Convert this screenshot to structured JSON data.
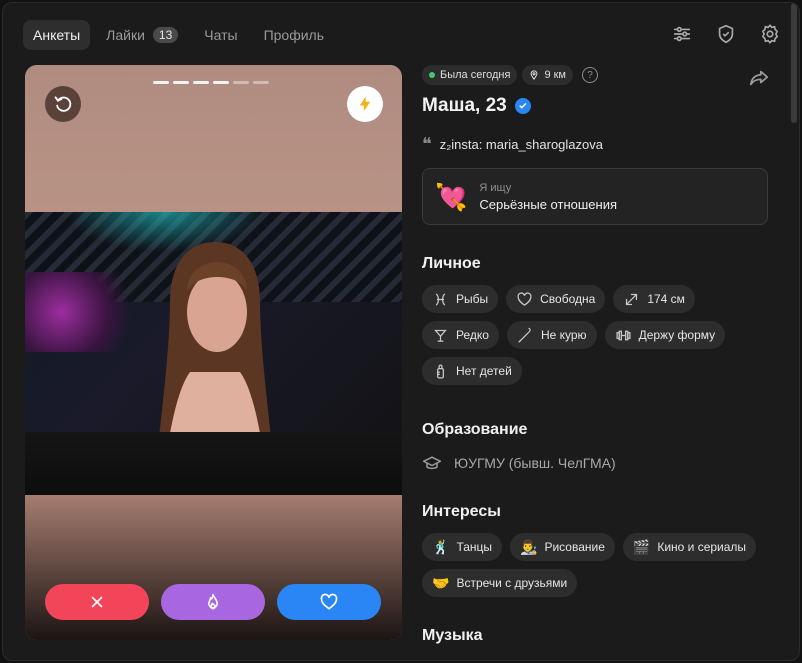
{
  "nav": {
    "tabs": [
      {
        "label": "Анкеты"
      },
      {
        "label": "Лайки",
        "badge": "13"
      },
      {
        "label": "Чаты"
      },
      {
        "label": "Профиль"
      }
    ]
  },
  "card": {
    "photo_count": 6,
    "current_photo": 4
  },
  "profile": {
    "status": "Была сегодня",
    "distance": "9 км",
    "help": "?",
    "name": "Маша, 23",
    "bio": "z₂insta: maria_sharoglazova",
    "seeking": {
      "label": "Я ищу",
      "value": "Серьёзные отношения"
    }
  },
  "sections": {
    "personal": {
      "title": "Личное",
      "items": [
        {
          "label": "Рыбы",
          "icon": "pisces-icon"
        },
        {
          "label": "Свободна",
          "icon": "heart-outline-icon"
        },
        {
          "label": "174 см",
          "icon": "expand-arrows-icon"
        },
        {
          "label": "Редко",
          "icon": "cocktail-glass-icon"
        },
        {
          "label": "Не курю",
          "icon": "no-smoking-icon"
        },
        {
          "label": "Держу форму",
          "icon": "dumbbell-icon"
        },
        {
          "label": "Нет детей",
          "icon": "baby-bottle-icon"
        }
      ]
    },
    "education": {
      "title": "Образование",
      "value": "ЮУГМУ (бывш. ЧелГМА)"
    },
    "interests": {
      "title": "Интересы",
      "items": [
        {
          "label": "Танцы",
          "emoji": "🕺"
        },
        {
          "label": "Рисование",
          "emoji": "👨‍🎨"
        },
        {
          "label": "Кино и сериалы",
          "emoji": "🎬"
        },
        {
          "label": "Встречи с друзьями",
          "emoji": "🤝"
        }
      ]
    },
    "music": {
      "title": "Музыка"
    }
  },
  "colors": {
    "dislike": "#f2455a",
    "superlike": "#a867e0",
    "like": "#2a86f4",
    "online": "#3ec96a"
  }
}
